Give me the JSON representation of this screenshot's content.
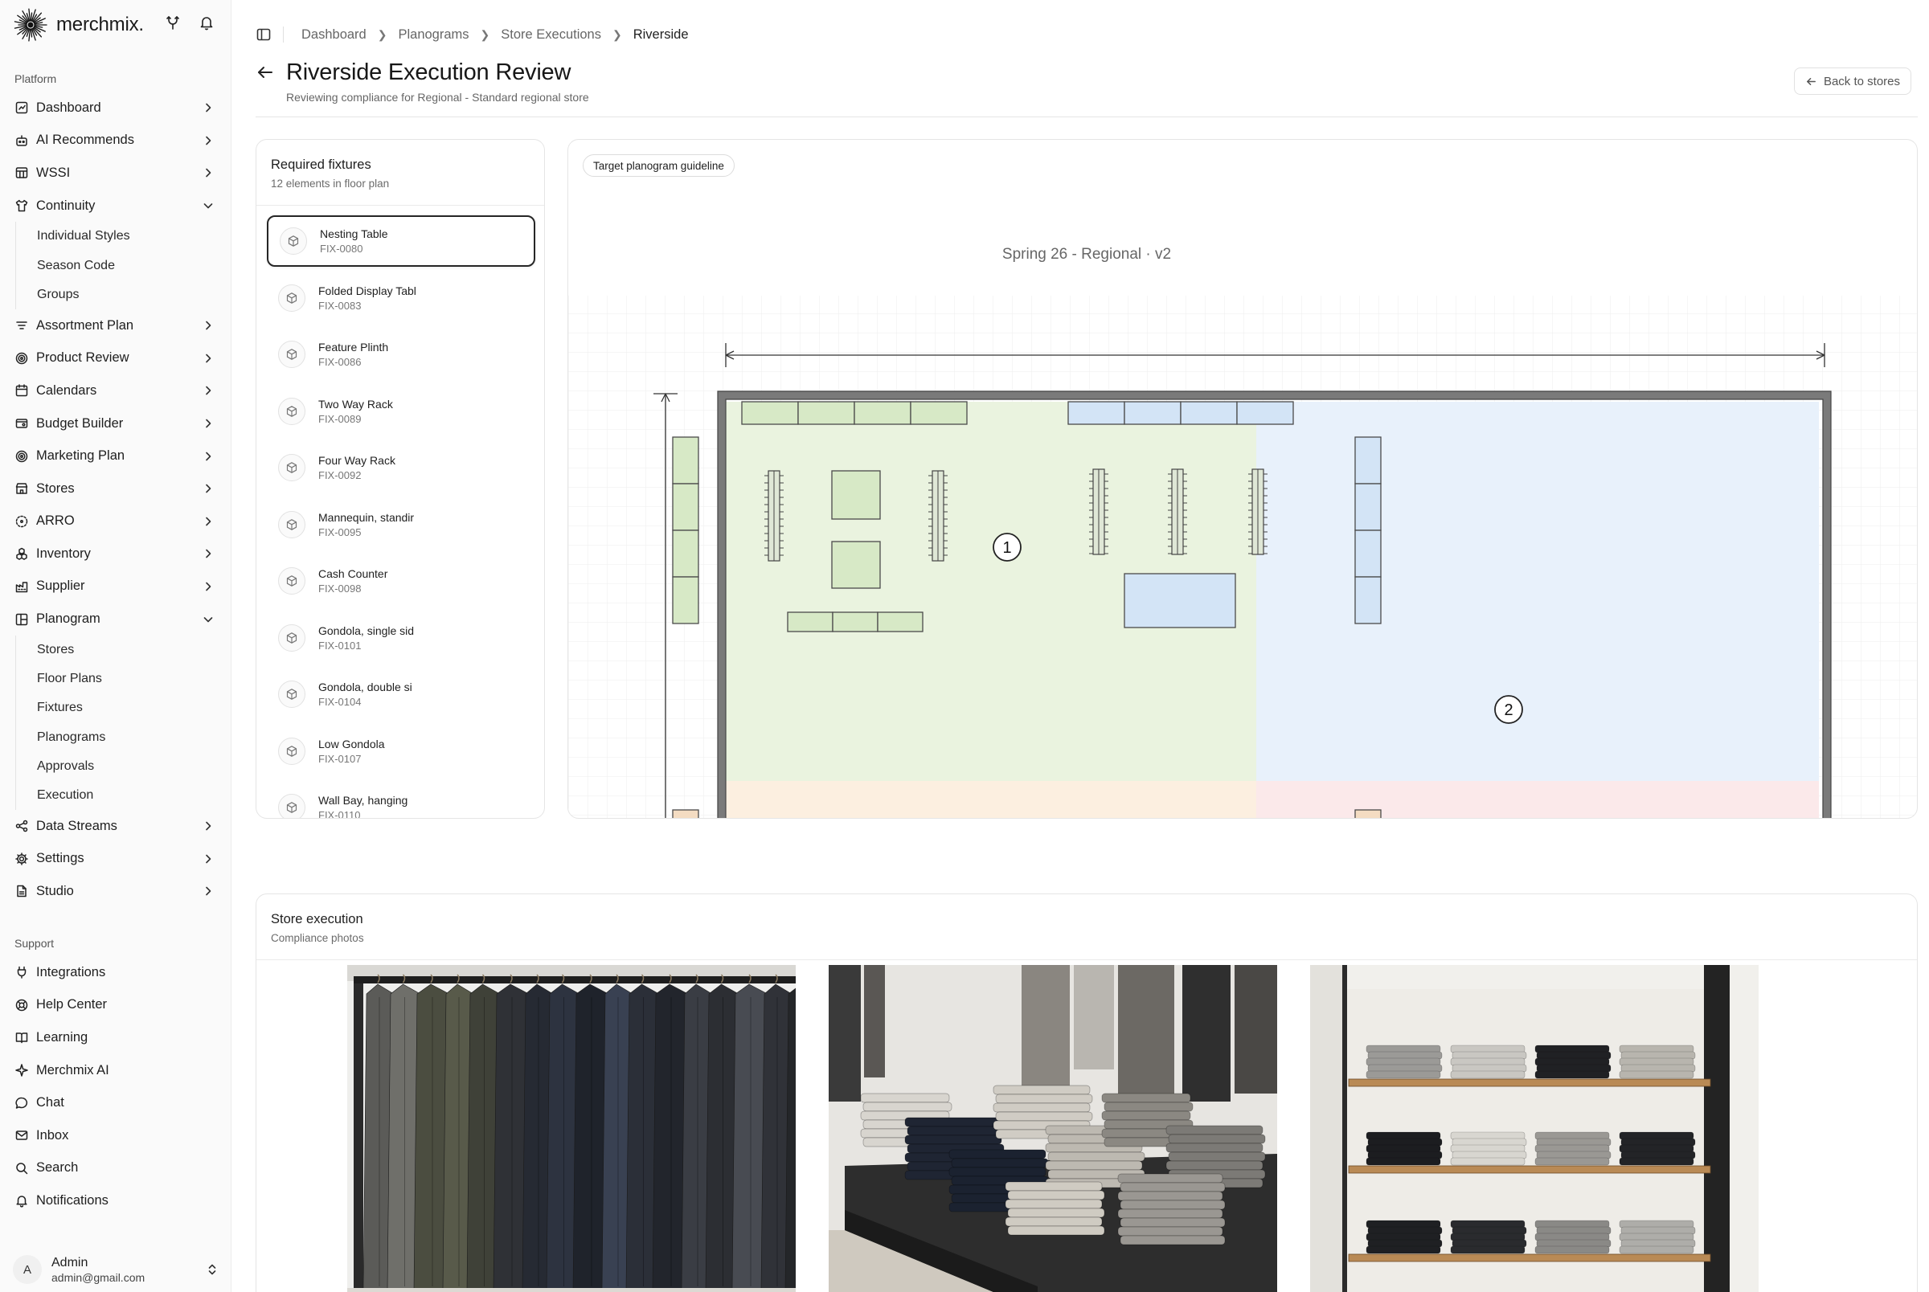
{
  "app": {
    "brand": "merchmix.",
    "colors": {
      "accent": "#1a1a1a",
      "zone_green": "#eaf3df",
      "zone_blue": "#e8f1fb",
      "fixture_green": "#d7e9c6",
      "fixture_blue": "#d3e4f6"
    }
  },
  "sidebar": {
    "platform_label": "Platform",
    "support_label": "Support",
    "items": [
      {
        "label": "Dashboard",
        "icon": "dashboard-icon"
      },
      {
        "label": "AI Recommends",
        "icon": "robot-icon"
      },
      {
        "label": "WSSI",
        "icon": "table-icon"
      },
      {
        "label": "Continuity",
        "icon": "shirt-icon",
        "expanded": true,
        "children": [
          "Individual Styles",
          "Season Code",
          "Groups"
        ]
      },
      {
        "label": "Assortment Plan",
        "icon": "list-filter-icon"
      },
      {
        "label": "Product Review",
        "icon": "target-icon"
      },
      {
        "label": "Calendars",
        "icon": "calendar-icon"
      },
      {
        "label": "Budget Builder",
        "icon": "budget-icon"
      },
      {
        "label": "Marketing Plan",
        "icon": "target-icon"
      },
      {
        "label": "Stores",
        "icon": "store-icon"
      },
      {
        "label": "ARRO",
        "icon": "dashed-circle-icon"
      },
      {
        "label": "Inventory",
        "icon": "boxes-icon"
      },
      {
        "label": "Supplier",
        "icon": "factory-icon"
      },
      {
        "label": "Planogram",
        "icon": "layout-icon",
        "expanded": true,
        "children": [
          "Stores",
          "Floor Plans",
          "Fixtures",
          "Planograms",
          "Approvals",
          "Execution"
        ]
      },
      {
        "label": "Data Streams",
        "icon": "share-icon"
      },
      {
        "label": "Settings",
        "icon": "gear-icon"
      },
      {
        "label": "Studio",
        "icon": "file-icon"
      }
    ],
    "support": [
      {
        "label": "Integrations",
        "icon": "plug-icon"
      },
      {
        "label": "Help Center",
        "icon": "life-buoy-icon"
      },
      {
        "label": "Learning",
        "icon": "book-icon"
      },
      {
        "label": "Merchmix AI",
        "icon": "sparkle-icon"
      },
      {
        "label": "Chat",
        "icon": "chat-icon"
      },
      {
        "label": "Inbox",
        "icon": "mail-icon"
      },
      {
        "label": "Search",
        "icon": "search-icon"
      },
      {
        "label": "Notifications",
        "icon": "bell-icon"
      }
    ],
    "user": {
      "initial": "A",
      "name": "Admin",
      "email": "admin@gmail.com"
    }
  },
  "breadcrumbs": [
    "Dashboard",
    "Planograms",
    "Store Executions",
    "Riverside"
  ],
  "header": {
    "title": "Riverside Execution Review",
    "subtitle": "Reviewing compliance for Regional - Standard regional store",
    "back_button": "Back to stores"
  },
  "fixtures": {
    "title": "Required fixtures",
    "subtitle": "12 elements in floor plan",
    "items": [
      {
        "name": "Nesting Table",
        "code": "FIX-0080",
        "selected": true
      },
      {
        "name": "Folded Display Tabl",
        "code": "FIX-0083"
      },
      {
        "name": "Feature Plinth",
        "code": "FIX-0086"
      },
      {
        "name": "Two Way Rack",
        "code": "FIX-0089"
      },
      {
        "name": "Four Way Rack",
        "code": "FIX-0092"
      },
      {
        "name": "Mannequin, standir",
        "code": "FIX-0095"
      },
      {
        "name": "Cash Counter",
        "code": "FIX-0098"
      },
      {
        "name": "Gondola, single sid",
        "code": "FIX-0101"
      },
      {
        "name": "Gondola, double si",
        "code": "FIX-0104"
      },
      {
        "name": "Low Gondola",
        "code": "FIX-0107"
      },
      {
        "name": "Wall Bay, hanging",
        "code": "FIX-0110"
      }
    ]
  },
  "planogram": {
    "tag": "Target planogram guideline",
    "plan_title": "Spring 26 - Regional · v2",
    "markers": [
      "1",
      "2"
    ]
  },
  "execution": {
    "title": "Store execution",
    "subtitle": "Compliance photos"
  }
}
